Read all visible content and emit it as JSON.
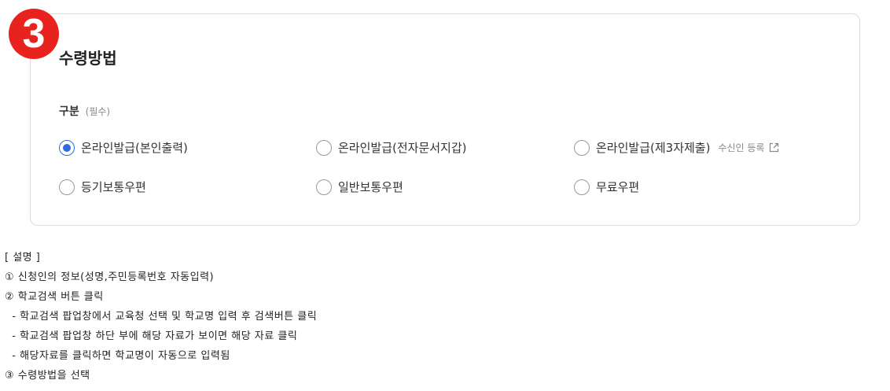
{
  "step_badge": "3",
  "section": {
    "title": "수령방법",
    "field_label": "구분",
    "field_required": "(필수)"
  },
  "options": [
    {
      "label": "온라인발급(본인출력)",
      "checked": true
    },
    {
      "label": "온라인발급(전자문서지갑)",
      "checked": false
    },
    {
      "label": "온라인발급(제3자제출)",
      "checked": false,
      "link_label": "수신인 등록",
      "link_icon": "external-link-icon"
    },
    {
      "label": "등기보통우편",
      "checked": false
    },
    {
      "label": "일반보통우편",
      "checked": false
    },
    {
      "label": "무료우편",
      "checked": false
    }
  ],
  "colors": {
    "accent": "#2b6de0",
    "badge": "#e8231f",
    "border": "#dcdcdc"
  },
  "description": {
    "heading": "[ 설명 ]",
    "lines": [
      "① 신청인의 정보(성명,주민등록번호 자동입력)",
      "② 학교검색 버튼 클릭",
      "  - 학교검색 팝업창에서 교육청 선택 및 학교명 입력 후 검색버튼 클릭",
      "  - 학교검색 팝업창 하단 부에 해당 자료가 보이면 해당 자료 클릭",
      "  - 해당자료를 클릭하면 학교명이 자동으로 입력됨",
      "③ 수령방법을 선택"
    ]
  }
}
